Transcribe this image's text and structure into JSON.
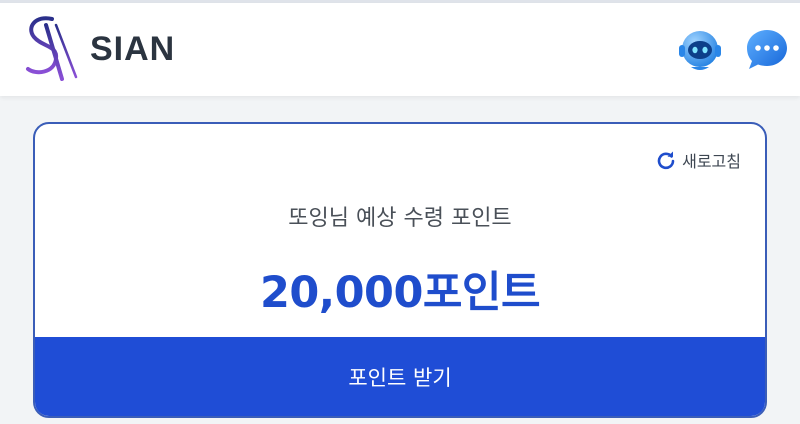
{
  "header": {
    "logo_text": "SIAN",
    "robot_icon": "robot-assistant-icon",
    "chat_icon": "chat-bubble-icon"
  },
  "card": {
    "refresh_label": "새로고침",
    "subtitle": "또잉님 예상 수령 포인트",
    "amount": "20,000포인트",
    "receive_button": "포인트 받기"
  },
  "colors": {
    "accent": "#1f4dd6",
    "amount_text": "#1f4dcc",
    "card_border": "#3a5db8",
    "logo_gradient_top": "#2a2f8a",
    "logo_gradient_bottom": "#8a4fd6"
  }
}
